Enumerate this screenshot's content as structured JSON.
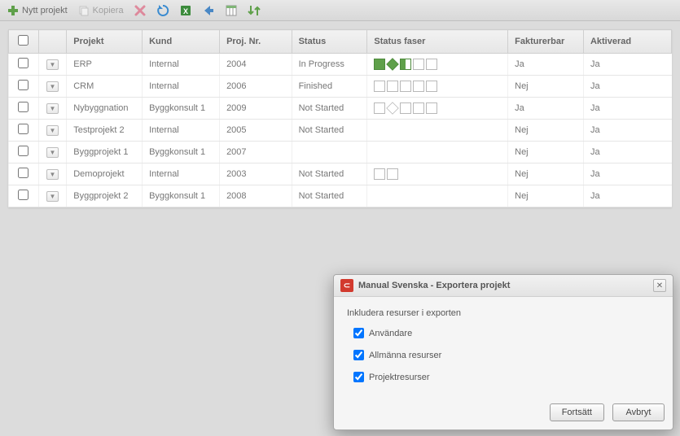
{
  "toolbar": {
    "new_project": "Nytt projekt",
    "copy": "Kopiera"
  },
  "columns": {
    "project": "Projekt",
    "customer": "Kund",
    "proj_nr": "Proj. Nr.",
    "status": "Status",
    "status_phases": "Status faser",
    "billable": "Fakturerbar",
    "activated": "Aktiverad"
  },
  "rows": [
    {
      "project": "ERP",
      "customer": "Internal",
      "nr": "2004",
      "status": "In Progress",
      "phases": [
        "fill",
        "diamond-fill",
        "half",
        "empty",
        "empty"
      ],
      "billable": "Ja",
      "activated": "Ja"
    },
    {
      "project": "CRM",
      "customer": "Internal",
      "nr": "2006",
      "status": "Finished",
      "phases": [
        "empty",
        "empty",
        "empty",
        "empty",
        "empty"
      ],
      "billable": "Nej",
      "activated": "Ja"
    },
    {
      "project": "Nybyggnation",
      "customer": "Byggkonsult 1",
      "nr": "2009",
      "status": "Not Started",
      "phases": [
        "empty",
        "diamond-outline",
        "empty",
        "empty",
        "empty"
      ],
      "billable": "Ja",
      "activated": "Ja"
    },
    {
      "project": "Testprojekt 2",
      "customer": "Internal",
      "nr": "2005",
      "status": "Not Started",
      "phases": [],
      "billable": "Nej",
      "activated": "Ja"
    },
    {
      "project": "Byggprojekt 1",
      "customer": "Byggkonsult 1",
      "nr": "2007",
      "status": "",
      "phases": [],
      "billable": "Nej",
      "activated": "Ja"
    },
    {
      "project": "Demoprojekt",
      "customer": "Internal",
      "nr": "2003",
      "status": "Not Started",
      "phases": [
        "empty",
        "empty"
      ],
      "billable": "Nej",
      "activated": "Ja"
    },
    {
      "project": "Byggprojekt 2",
      "customer": "Byggkonsult 1",
      "nr": "2008",
      "status": "Not Started",
      "phases": [],
      "billable": "Nej",
      "activated": "Ja"
    }
  ],
  "dialog": {
    "title": "Manual Svenska - Exportera projekt",
    "subtitle": "Inkludera resurser i exporten",
    "options": [
      {
        "label": "Användare",
        "checked": true
      },
      {
        "label": "Allmänna resurser",
        "checked": true
      },
      {
        "label": "Projektresurser",
        "checked": true
      }
    ],
    "continue": "Fortsätt",
    "cancel": "Avbryt"
  }
}
